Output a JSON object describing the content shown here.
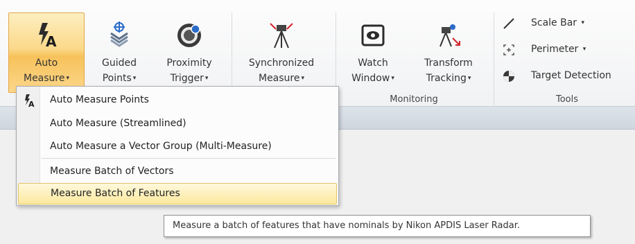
{
  "ribbon": {
    "buttons": [
      {
        "id": "auto-measure",
        "line1": "Auto",
        "line2": "Measure",
        "caret": "▾",
        "icon": "auto-measure-icon"
      },
      {
        "id": "guided-points",
        "line1": "Guided",
        "line2": "Points",
        "caret": "▾",
        "icon": "guided-points-icon"
      },
      {
        "id": "proximity-trigger",
        "line1": "Proximity",
        "line2": "Trigger",
        "caret": "▾",
        "icon": "proximity-trigger-icon"
      },
      {
        "id": "synchronized-measure",
        "line1": "Synchronized",
        "line2": "Measure",
        "caret": "▾",
        "icon": "synchronized-measure-icon"
      },
      {
        "id": "watch-window",
        "line1": "Watch",
        "line2": "Window",
        "caret": "▾",
        "icon": "watch-window-icon"
      },
      {
        "id": "transform-tracking",
        "line1": "Transform",
        "line2": "Tracking",
        "caret": "▾",
        "icon": "transform-tracking-icon"
      }
    ],
    "groups": {
      "monitoring": "Monitoring",
      "tools": "Tools"
    },
    "tools_items": [
      {
        "label": "Scale Bar",
        "caret": "▾",
        "icon": "scale-bar-icon"
      },
      {
        "label": "Perimeter",
        "caret": "▾",
        "icon": "perimeter-icon"
      },
      {
        "label": "Target Detection",
        "caret": "",
        "icon": "target-detection-icon"
      }
    ]
  },
  "menu": {
    "items": [
      {
        "label": "Auto Measure Points",
        "icon": "auto-measure-icon"
      },
      {
        "label": "Auto Measure (Streamlined)"
      },
      {
        "label": "Auto Measure a Vector Group (Multi-Measure)"
      },
      {
        "label": "Measure Batch of Vectors"
      },
      {
        "label": "Measure Batch of Features",
        "highlighted": true
      }
    ]
  },
  "tooltip": {
    "text": "Measure a batch of features that have nominals by Nikon APDIS Laser Radar."
  },
  "colors": {
    "active_button": "#f9c860",
    "menu_highlight": "#fde99e",
    "accent_red": "#d4252a",
    "accent_blue": "#2a6bc9"
  }
}
